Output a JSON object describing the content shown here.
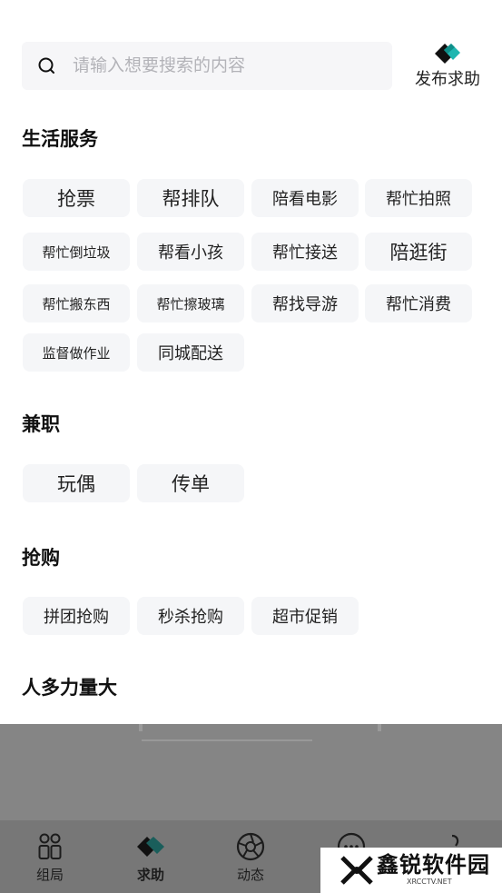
{
  "search": {
    "placeholder": "请输入想要搜索的内容",
    "icon": "search-icon"
  },
  "publish": {
    "label": "发布求助",
    "icon": "handshake-icon"
  },
  "sections": {
    "life": {
      "title": "生活服务",
      "items": [
        "抢票",
        "帮排队",
        "陪看电影",
        "帮忙拍照",
        "帮忙倒垃圾",
        "帮看小孩",
        "帮忙接送",
        "陪逛街",
        "帮忙搬东西",
        "帮忙擦玻璃",
        "帮找导游",
        "帮忙消费",
        "监督做作业",
        "同城配送"
      ]
    },
    "parttime": {
      "title": "兼职",
      "items": [
        "玩偶",
        "传单"
      ]
    },
    "rush": {
      "title": "抢购",
      "items": [
        "拼团抢购",
        "秒杀抢购",
        "超市促销"
      ]
    },
    "crowd": {
      "title": "人多力量大"
    }
  },
  "tabs": [
    {
      "label": "组局",
      "icon": "group-icon"
    },
    {
      "label": "求助",
      "icon": "handshake-icon",
      "active": true
    },
    {
      "label": "动态",
      "icon": "aperture-icon"
    }
  ],
  "watermark": {
    "text": "鑫锐软件园",
    "sub": "XRCCTV.NET"
  },
  "colors": {
    "chip_bg": "#f5f6f8",
    "search_bg": "#f6f6f8",
    "overlay": "#777777",
    "brand_teal": "#1fb6b0"
  }
}
